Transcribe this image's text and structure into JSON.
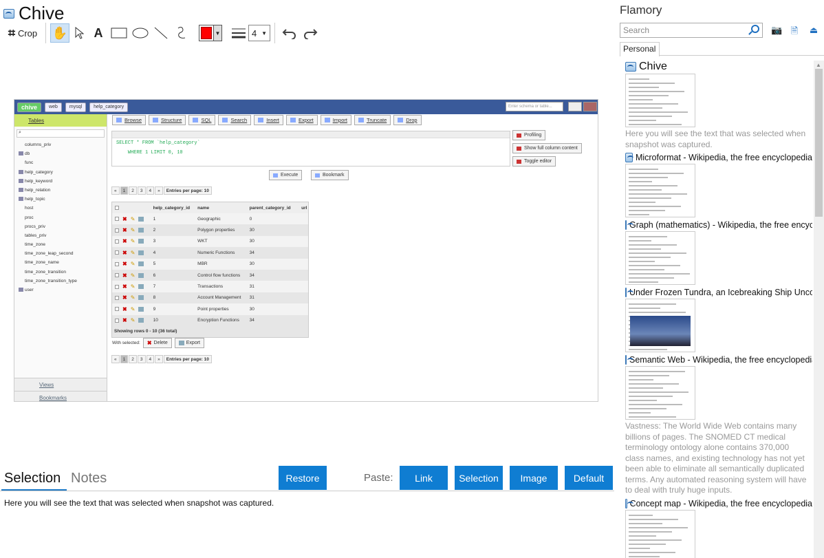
{
  "app": {
    "title": "Chive"
  },
  "toolbar": {
    "crop_label": "Crop",
    "stroke_width": "4",
    "accent_color": "#ff0000"
  },
  "embedded": {
    "brand": "chive",
    "crumbs": [
      "web",
      "mysql",
      "help_category"
    ],
    "search_placeholder": "Enter schema or table...",
    "sidebar_header": "Tables",
    "tables": [
      "columns_priv",
      "db",
      "func",
      "help_category",
      "help_keyword",
      "help_relation",
      "help_topic",
      "host",
      "proc",
      "procs_priv",
      "tables_priv",
      "time_zone",
      "time_zone_leap_second",
      "time_zone_name",
      "time_zone_transition",
      "time_zone_transition_type",
      "user"
    ],
    "footer": [
      "Views",
      "Bookmarks"
    ],
    "tabs": [
      "Browse",
      "Structure",
      "SQL",
      "Search",
      "Insert",
      "Export",
      "Import",
      "Truncate",
      "Drop"
    ],
    "sql_line1": "SELECT * FROM `help_category`",
    "sql_line2": "    WHERE 1 LIMIT 0, 10",
    "right_buttons": [
      "Profiling",
      "Show full column content",
      "Toggle editor"
    ],
    "execute_label": "Execute",
    "bookmark_label": "Bookmark",
    "pager_pages": [
      "«",
      "1",
      "2",
      "3",
      "4",
      "»"
    ],
    "entries_label": "Entries per page:",
    "entries_value": "10",
    "columns": [
      "help_category_id",
      "name",
      "parent_category_id",
      "url"
    ],
    "rows": [
      {
        "id": "1",
        "name": "Geographic",
        "parent": "0"
      },
      {
        "id": "2",
        "name": "Polygon properties",
        "parent": "30"
      },
      {
        "id": "3",
        "name": "WKT",
        "parent": "30"
      },
      {
        "id": "4",
        "name": "Numeric Functions",
        "parent": "34"
      },
      {
        "id": "5",
        "name": "MBR",
        "parent": "30"
      },
      {
        "id": "6",
        "name": "Control flow functions",
        "parent": "34"
      },
      {
        "id": "7",
        "name": "Transactions",
        "parent": "31"
      },
      {
        "id": "8",
        "name": "Account Management",
        "parent": "31"
      },
      {
        "id": "9",
        "name": "Point properties",
        "parent": "30"
      },
      {
        "id": "10",
        "name": "Encryption Functions",
        "parent": "34"
      }
    ],
    "showing": "Showing rows 0 - 10 (36 total)",
    "with_selected": "With selected:",
    "delete_label": "Delete",
    "export_label": "Export"
  },
  "bottom": {
    "tab_selection": "Selection",
    "tab_notes": "Notes",
    "restore": "Restore",
    "paste_label": "Paste:",
    "link": "Link",
    "selection": "Selection",
    "image": "Image",
    "default": "Default",
    "selected_text": "Here you will see the text that was selected when snapshot was captured."
  },
  "panel": {
    "title": "Flamory",
    "search_placeholder": "Search",
    "tab": "Personal",
    "items": [
      {
        "title": "Chive",
        "desc": "Here you will see the text that was selected when snapshot was captured."
      },
      {
        "title": "Microformat - Wikipedia, the free encyclopedia",
        "desc": ""
      },
      {
        "title": "Graph (mathematics) - Wikipedia, the free encyclopedia",
        "desc": ""
      },
      {
        "title": "Under Frozen Tundra, an Icebreaking Ship Uncovers",
        "desc": ""
      },
      {
        "title": "Semantic Web - Wikipedia, the free encyclopedia",
        "desc": "Vastness: The World Wide Web contains many billions of pages. The SNOMED CT medical terminology ontology alone contains 370,000 class names, and existing technology has not yet been able to eliminate all semantically duplicated terms. Any automated reasoning system will have to deal with truly huge inputs."
      },
      {
        "title": "Concept map - Wikipedia, the free encyclopedia",
        "desc": ""
      }
    ]
  }
}
